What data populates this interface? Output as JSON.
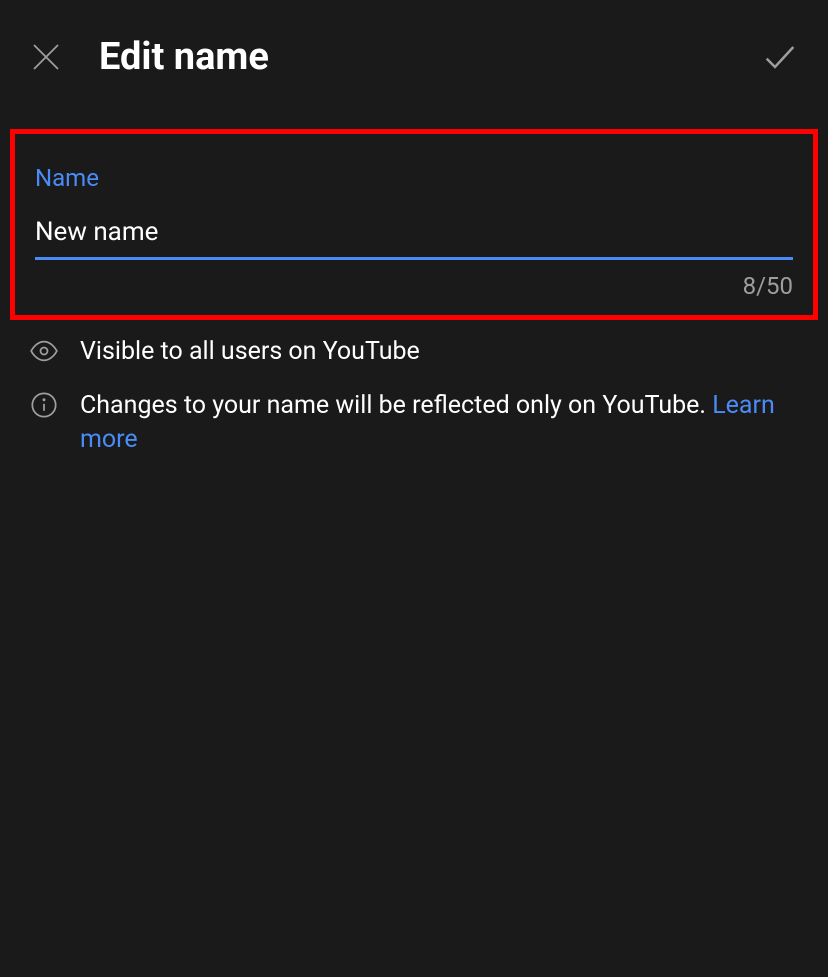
{
  "header": {
    "title": "Edit name"
  },
  "form": {
    "field_label": "Name",
    "name_value": "New name",
    "char_counter": "8/50"
  },
  "info": {
    "visibility_text": "Visible to all users on YouTube",
    "changes_text": "Changes to your name will be reflected only on YouTube. ",
    "learn_more_label": "Learn more"
  }
}
